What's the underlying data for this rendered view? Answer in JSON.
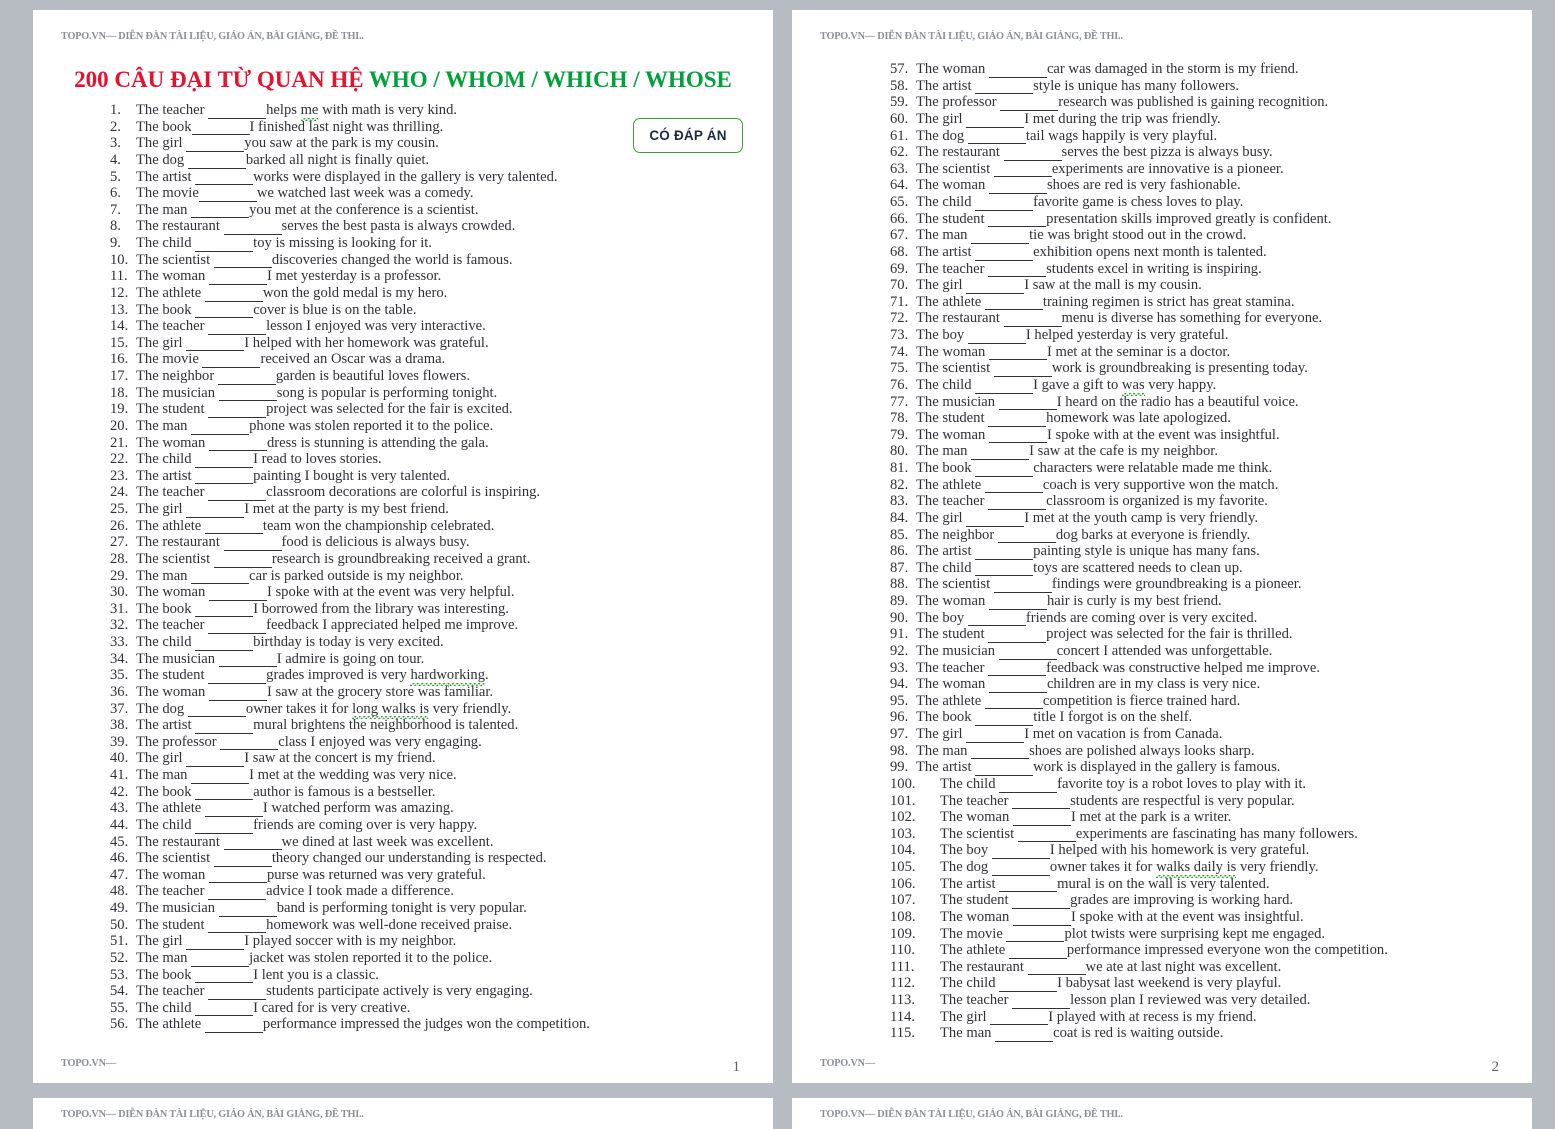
{
  "document": {
    "running_header": "TOPO.VN— DIỄN ĐÀN TÀI LIỆU, GIÁO ÁN, BÀI GIẢNG, ĐỀ THI..",
    "running_footer": "TOPO.VN—",
    "title_red": "200 CÂU ĐẠI TỪ QUAN HỆ ",
    "title_green": "WHO / WHOM / WHICH / WHOSE",
    "badge_label": "CÓ ĐÁP ÁN",
    "colors": {
      "title_red": "#e8112d",
      "title_green": "#00a13a",
      "badge_border": "#3f9b35",
      "badge_text": "#1d2a3a",
      "header_gray": "#8a8f96",
      "body_text": "#2f3238",
      "page_background": "#b6bcc2",
      "squiggle_green": "#2aa02a"
    }
  },
  "pages": [
    {
      "number": "1",
      "questions": [
        {
          "n": "1.",
          "pre": "The teacher ",
          "post": "helps ",
          "sq": "me",
          "tail": " with math is very kind."
        },
        {
          "n": "2.",
          "pre": "The book",
          "post": "I finished last night was thrilling."
        },
        {
          "n": "3.",
          "pre": "The girl ",
          "post": "you saw at the park is my cousin."
        },
        {
          "n": "4.",
          "pre": "The dog ",
          "post": "barked all night is finally quiet."
        },
        {
          "n": "5.",
          "pre": "The artist ",
          "post": "works were displayed in the gallery is very talented."
        },
        {
          "n": "6.",
          "pre": "The movie",
          "post": "we watched last week was a comedy."
        },
        {
          "n": "7.",
          "pre": "The man ",
          "post": "you met at the conference is a scientist."
        },
        {
          "n": "8.",
          "pre": "The restaurant ",
          "post": "serves the best pasta is always crowded."
        },
        {
          "n": "9.",
          "pre": "The child ",
          "post": "toy is missing is looking for it."
        },
        {
          "n": "10.",
          "pre": "The scientist ",
          "post": "discoveries changed the world is famous."
        },
        {
          "n": "11.",
          "pre": "The woman ",
          "post": "I met yesterday is a professor."
        },
        {
          "n": "12.",
          "pre": "The athlete ",
          "post": "won the gold medal is my hero."
        },
        {
          "n": "13.",
          "pre": "The book ",
          "post": "cover is blue is on the table."
        },
        {
          "n": "14.",
          "pre": "The teacher ",
          "post": "lesson I enjoyed was very interactive."
        },
        {
          "n": "15.",
          "pre": "The girl ",
          "post": "I helped with her homework was grateful."
        },
        {
          "n": "16.",
          "pre": "The movie ",
          "post": "received an Oscar was a drama."
        },
        {
          "n": "17.",
          "pre": "The neighbor ",
          "post": "garden is beautiful loves flowers."
        },
        {
          "n": "18.",
          "pre": "The musician ",
          "post": "song is popular is performing tonight."
        },
        {
          "n": "19.",
          "pre": "The student ",
          "post": "project was selected for the fair is excited."
        },
        {
          "n": "20.",
          "pre": "The man ",
          "post": "phone was stolen reported it to the police."
        },
        {
          "n": "21.",
          "pre": "The woman ",
          "post": "dress is stunning is attending the gala."
        },
        {
          "n": "22.",
          "pre": "The child ",
          "post": "I read to loves stories."
        },
        {
          "n": "23.",
          "pre": "The artist ",
          "post": "painting I bought is very talented."
        },
        {
          "n": "24.",
          "pre": "The teacher ",
          "post": "classroom decorations are colorful is inspiring."
        },
        {
          "n": "25.",
          "pre": "The girl ",
          "post": "I met at the party is my best friend."
        },
        {
          "n": "26.",
          "pre": "The athlete ",
          "post": "team won the championship celebrated."
        },
        {
          "n": "27.",
          "pre": "The restaurant ",
          "post": "food is delicious is always busy."
        },
        {
          "n": "28.",
          "pre": "The scientist ",
          "post": "research is groundbreaking received a grant."
        },
        {
          "n": "29.",
          "pre": "The man ",
          "post": "car is parked outside is my neighbor."
        },
        {
          "n": "30.",
          "pre": "The woman ",
          "post": "I spoke with at the event was very helpful."
        },
        {
          "n": "31.",
          "pre": "The book ",
          "post": "I borrowed from the library was interesting."
        },
        {
          "n": "32.",
          "pre": "The teacher ",
          "post": "feedback I appreciated helped me improve."
        },
        {
          "n": "33.",
          "pre": "The child ",
          "post": "birthday is today is very excited."
        },
        {
          "n": "34.",
          "pre": "The musician ",
          "post": "I admire is going on tour."
        },
        {
          "n": "35.",
          "pre": "The student ",
          "post": "grades improved is very ",
          "sq": "hardworking",
          "tail": "."
        },
        {
          "n": "36.",
          "pre": "The woman ",
          "post": "I saw at the grocery store was familiar."
        },
        {
          "n": "37.",
          "pre": "The dog ",
          "post": "owner takes it for ",
          "sq": "long walks is",
          "tail": " very friendly."
        },
        {
          "n": "38.",
          "pre": "The artist ",
          "post": "mural brightens the neighborhood is talented."
        },
        {
          "n": "39.",
          "pre": "The professor ",
          "post": "class I enjoyed was very engaging."
        },
        {
          "n": "40.",
          "pre": "The girl ",
          "post": "I saw at the concert is my friend."
        },
        {
          "n": "41.",
          "pre": "The man ",
          "post": "I met at the wedding was very nice."
        },
        {
          "n": "42.",
          "pre": "The book ",
          "post": "author is famous is a bestseller."
        },
        {
          "n": "43.",
          "pre": "The athlete ",
          "post": "I watched perform was amazing."
        },
        {
          "n": "44.",
          "pre": "The child ",
          "post": "friends are coming over is very happy."
        },
        {
          "n": "45.",
          "pre": "The restaurant ",
          "post": "we dined at last week was excellent."
        },
        {
          "n": "46.",
          "pre": "The scientist ",
          "post": "theory changed our understanding is respected."
        },
        {
          "n": "47.",
          "pre": "The woman ",
          "post": "purse was returned was very grateful."
        },
        {
          "n": "48.",
          "pre": "The teacher ",
          "post": "advice I took made a difference."
        },
        {
          "n": "49.",
          "pre": "The musician ",
          "post": "band is performing tonight is very popular."
        },
        {
          "n": "50.",
          "pre": "The student ",
          "post": "homework was well-done received praise."
        },
        {
          "n": "51.",
          "pre": "The girl ",
          "post": "I played soccer with is my neighbor."
        },
        {
          "n": "52.",
          "pre": "The man ",
          "post": "jacket was stolen reported it to the police."
        },
        {
          "n": "53.",
          "pre": "The book ",
          "post": "I lent you is a classic."
        },
        {
          "n": "54.",
          "pre": "The teacher ",
          "post": "students participate actively is very engaging."
        },
        {
          "n": "55.",
          "pre": "The child ",
          "post": "I cared for is very creative."
        },
        {
          "n": "56.",
          "pre": "The athlete ",
          "post": "performance impressed the judges won the competition."
        }
      ]
    },
    {
      "number": "2",
      "questions": [
        {
          "n": "57.",
          "pre": "The woman ",
          "post": "car was damaged in the storm is my friend."
        },
        {
          "n": "58.",
          "pre": "The artist ",
          "post": "style is unique has many followers."
        },
        {
          "n": "59.",
          "pre": "The professor ",
          "post": "research was published is gaining recognition."
        },
        {
          "n": "60.",
          "pre": "The girl ",
          "post": "I met during the trip was friendly."
        },
        {
          "n": "61.",
          "pre": "The dog ",
          "post": "tail wags happily is very playful."
        },
        {
          "n": "62.",
          "pre": "The restaurant ",
          "post": "serves the best pizza is always busy."
        },
        {
          "n": "63.",
          "pre": "The scientist ",
          "post": "experiments are innovative is a pioneer."
        },
        {
          "n": "64.",
          "pre": "The woman ",
          "post": "shoes are red is very fashionable."
        },
        {
          "n": "65.",
          "pre": "The child ",
          "post": "favorite game is chess loves to play."
        },
        {
          "n": "66.",
          "pre": "The student ",
          "post": "presentation skills improved greatly is confident."
        },
        {
          "n": "67.",
          "pre": "The man ",
          "post": "tie was bright stood out in the crowd."
        },
        {
          "n": "68.",
          "pre": "The artist ",
          "post": "exhibition opens next month is talented."
        },
        {
          "n": "69.",
          "pre": "The teacher ",
          "post": "students excel in writing is inspiring."
        },
        {
          "n": "70.",
          "pre": "The girl ",
          "post": "I saw at the mall is my cousin."
        },
        {
          "n": "71.",
          "pre": "The athlete ",
          "post": "training regimen is strict has great stamina."
        },
        {
          "n": "72.",
          "pre": "The restaurant ",
          "post": "menu is diverse has something for everyone."
        },
        {
          "n": "73.",
          "pre": "The boy ",
          "post": "I helped yesterday is very grateful."
        },
        {
          "n": "74.",
          "pre": "The woman ",
          "post": "I met at the seminar is a doctor."
        },
        {
          "n": "75.",
          "pre": "The scientist ",
          "post": "work is groundbreaking is presenting today."
        },
        {
          "n": "76.",
          "pre": "The child ",
          "post": "I gave a gift to ",
          "sq": "was",
          "tail": " very happy."
        },
        {
          "n": "77.",
          "pre": "The musician ",
          "post": "I heard on the radio has a beautiful voice."
        },
        {
          "n": "78.",
          "pre": "The student ",
          "post": "homework was late apologized."
        },
        {
          "n": "79.",
          "pre": "The woman ",
          "post": "I spoke with at the event was insightful."
        },
        {
          "n": "80.",
          "pre": "The man ",
          "post": "I saw at the cafe is my neighbor."
        },
        {
          "n": "81.",
          "pre": "The book ",
          "post": "characters were relatable made me think."
        },
        {
          "n": "82.",
          "pre": "The athlete ",
          "post": "coach is very supportive won the match."
        },
        {
          "n": "83.",
          "pre": "The teacher ",
          "post": "classroom is organized is my favorite."
        },
        {
          "n": "84.",
          "pre": "The girl ",
          "post": "I met at the youth camp is very friendly."
        },
        {
          "n": "85.",
          "pre": "The neighbor ",
          "post": "dog barks at everyone is friendly."
        },
        {
          "n": "86.",
          "pre": "The artist ",
          "post": "painting style is unique has many fans."
        },
        {
          "n": "87.",
          "pre": "The child ",
          "post": "toys are scattered needs to clean up."
        },
        {
          "n": "88.",
          "pre": "The scientist ",
          "post": "findings were groundbreaking is a pioneer."
        },
        {
          "n": "89.",
          "pre": "The woman ",
          "post": "hair is curly is my best friend."
        },
        {
          "n": "90.",
          "pre": "The boy ",
          "post": "friends are coming over is very excited."
        },
        {
          "n": "91.",
          "pre": "The student ",
          "post": "project was selected for the fair is thrilled."
        },
        {
          "n": "92.",
          "pre": "The musician ",
          "post": "concert I attended was unforgettable."
        },
        {
          "n": "93.",
          "pre": "The teacher ",
          "post": "feedback was constructive helped me improve."
        },
        {
          "n": "94.",
          "pre": "The woman ",
          "post": "children are in my class is very nice."
        },
        {
          "n": "95.",
          "pre": "The athlete ",
          "post": "competition is fierce trained hard."
        },
        {
          "n": "96.",
          "pre": "The book ",
          "post": "title I forgot is on the shelf."
        },
        {
          "n": "97.",
          "pre": "The girl ",
          "post": "I met on vacation is from Canada."
        },
        {
          "n": "98.",
          "pre": "The man ",
          "post": "shoes are polished always looks sharp."
        },
        {
          "n": "99.",
          "pre": "The artist ",
          "post": "work is displayed in the gallery is famous."
        },
        {
          "n": "100.",
          "wide": true,
          "pre": "The child ",
          "post": "favorite toy is a robot loves to play with it."
        },
        {
          "n": "101.",
          "wide": true,
          "pre": "The teacher ",
          "post": "students are respectful is very popular."
        },
        {
          "n": "102.",
          "wide": true,
          "pre": "The woman ",
          "post": "I met at the park is a writer."
        },
        {
          "n": "103.",
          "wide": true,
          "pre": "The scientist ",
          "post": "experiments are fascinating has many followers."
        },
        {
          "n": "104.",
          "wide": true,
          "pre": "The boy ",
          "post": "I helped with his homework is very grateful."
        },
        {
          "n": "105.",
          "wide": true,
          "pre": "The dog ",
          "post": "owner takes it for ",
          "sq": "walks daily is",
          "tail": " very friendly."
        },
        {
          "n": "106.",
          "wide": true,
          "pre": "The artist ",
          "post": "mural is on the wall is very talented."
        },
        {
          "n": "107.",
          "wide": true,
          "pre": "The student ",
          "post": "grades are improving is working hard."
        },
        {
          "n": "108.",
          "wide": true,
          "pre": "The woman ",
          "post": "I spoke with at the event was insightful."
        },
        {
          "n": "109.",
          "wide": true,
          "pre": "The movie ",
          "post": "plot twists were surprising kept me engaged."
        },
        {
          "n": "110.",
          "wide": true,
          "pre": "The athlete ",
          "post": "performance impressed everyone won the competition."
        },
        {
          "n": "111.",
          "wide": true,
          "pre": "The restaurant ",
          "post": "we ate at last night was excellent."
        },
        {
          "n": "112.",
          "wide": true,
          "pre": "The child ",
          "post": "I babysat last weekend is very playful."
        },
        {
          "n": "113.",
          "wide": true,
          "pre": "The teacher ",
          "post": "lesson plan I reviewed was very detailed."
        },
        {
          "n": "114.",
          "wide": true,
          "pre": "The girl ",
          "post": "I played with at recess is my friend."
        },
        {
          "n": "115.",
          "wide": true,
          "pre": "The man ",
          "post": "coat is red is waiting outside."
        }
      ]
    }
  ]
}
